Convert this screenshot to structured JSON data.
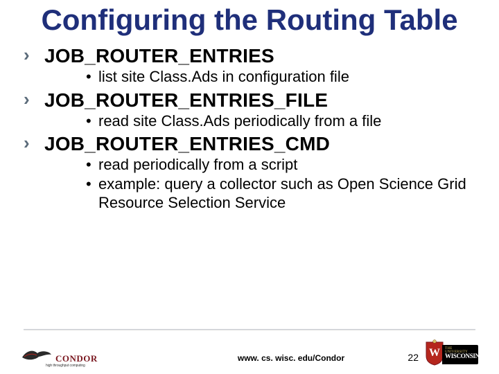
{
  "title": "Configuring the Routing Table",
  "items": [
    {
      "heading": "JOB_ROUTER_ENTRIES",
      "subs": [
        "list site Class.Ads in configuration file"
      ]
    },
    {
      "heading": "JOB_ROUTER_ENTRIES_FILE",
      "subs": [
        "read site Class.Ads periodically from a file"
      ]
    },
    {
      "heading": "JOB_ROUTER_ENTRIES_CMD",
      "subs": [
        "read periodically from a script",
        "example: query a collector such as Open Science Grid Resource Selection Service"
      ]
    }
  ],
  "footer": {
    "condor_name": "CONDOR",
    "condor_tag": "high throughput computing",
    "url": "www. cs. wisc. edu/Condor",
    "page_number": "22",
    "wisc_top": "THE UNIVERSITY",
    "wisc_main": "WISCONSIN"
  }
}
